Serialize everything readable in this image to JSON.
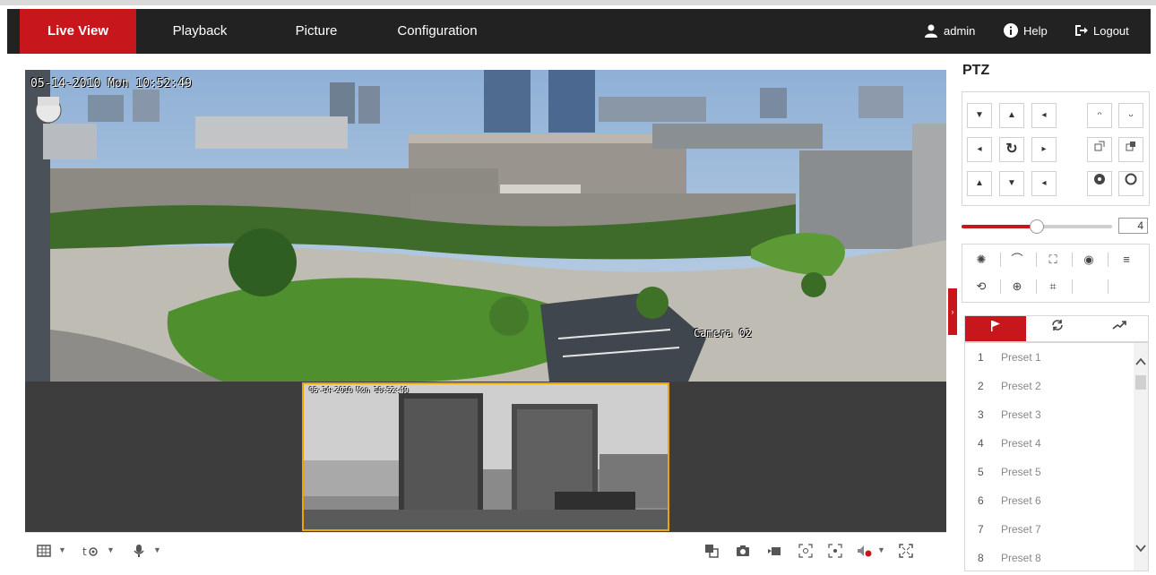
{
  "nav": {
    "tabs": [
      {
        "label": "Live View",
        "active": true
      },
      {
        "label": "Playback"
      },
      {
        "label": "Picture"
      },
      {
        "label": "Configuration"
      }
    ],
    "user": "admin",
    "help": "Help",
    "logout": "Logout",
    "accent": "#c8161d"
  },
  "video": {
    "main_timestamp": "05-14-2010 Mon 10:52:49",
    "camera_label": "Camera 02",
    "pip_timestamp": "05-14-2010 Mon 10:52:49"
  },
  "ptz": {
    "title": "PTZ",
    "speed": "4",
    "speed_fraction": 0.5,
    "tabs": [
      "preset-icon",
      "patrol-icon",
      "pattern-icon"
    ],
    "presets": [
      {
        "num": "1",
        "name": "Preset 1"
      },
      {
        "num": "2",
        "name": "Preset 2"
      },
      {
        "num": "3",
        "name": "Preset 3"
      },
      {
        "num": "4",
        "name": "Preset 4"
      },
      {
        "num": "5",
        "name": "Preset 5"
      },
      {
        "num": "6",
        "name": "Preset 6"
      },
      {
        "num": "7",
        "name": "Preset 7"
      },
      {
        "num": "8",
        "name": "Preset 8"
      }
    ]
  },
  "toolbar": {
    "left": [
      "window-layout-icon",
      "stream-type-icon",
      "microphone-icon"
    ],
    "right": [
      "window-split-icon",
      "capture-icon",
      "record-icon",
      "digital-zoom-icon",
      "3d-positioning-icon",
      "audio-mute-icon",
      "fullscreen-icon"
    ]
  }
}
